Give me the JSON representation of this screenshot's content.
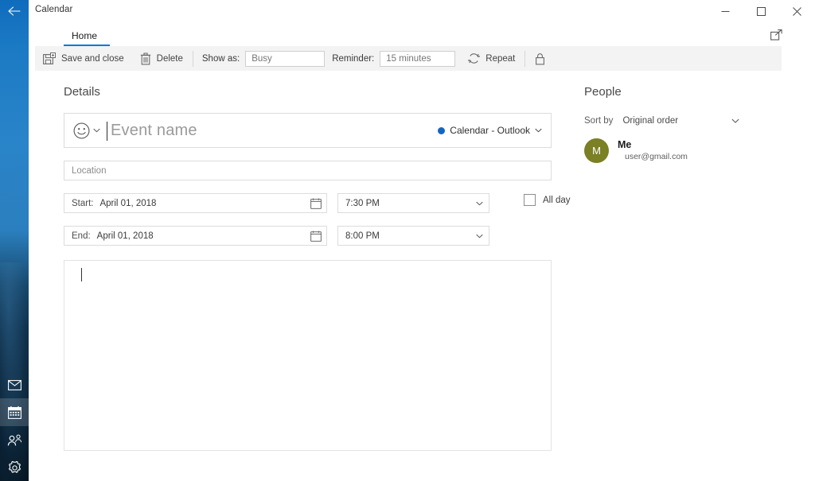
{
  "window": {
    "app_title": "Calendar",
    "back_icon": "arrow-left-icon",
    "minimize_label": "—",
    "maximize_label": "⬜",
    "close_label": "✕"
  },
  "rail": {
    "items": [
      {
        "name": "mail",
        "icon": "mail-icon",
        "active": false
      },
      {
        "name": "calendar",
        "icon": "calendar-icon",
        "active": true
      },
      {
        "name": "people",
        "icon": "people-icon",
        "active": false
      },
      {
        "name": "settings",
        "icon": "gear-icon",
        "active": false
      }
    ]
  },
  "ribbon": {
    "tab_label": "Home",
    "popout_icon": "open-in-new-window-icon",
    "save_label": "Save and close",
    "save_icon": "save-icon",
    "delete_label": "Delete",
    "delete_icon": "trash-icon",
    "show_as_label": "Show as:",
    "show_as_value": "Busy",
    "reminder_label": "Reminder:",
    "reminder_value": "15 minutes",
    "repeat_label": "Repeat",
    "repeat_icon": "repeat-icon",
    "private_icon": "lock-icon"
  },
  "details": {
    "heading": "Details",
    "emoji_icon": "smiley-icon",
    "emoji_chevron": "chevron-down-icon",
    "event_name_value": "",
    "event_name_placeholder": "Event name",
    "calendar_name": "Calendar - Outlook",
    "calendar_color": "#1565c0",
    "calendar_chevron": "chevron-down-icon",
    "location_value": "",
    "location_placeholder": "Location",
    "start_label": "Start:",
    "start_date": "April 01, 2018",
    "start_time": "7:30 PM",
    "end_label": "End:",
    "end_date": "April 01, 2018",
    "end_time": "8:00 PM",
    "date_picker_icon": "calendar-picker-icon",
    "time_chevron": "chevron-down-icon",
    "all_day_label": "All day",
    "all_day_checked": false,
    "notes_value": ""
  },
  "people": {
    "heading": "People",
    "sort_by_label": "Sort by",
    "sort_by_value": "Original order",
    "sort_chevron": "chevron-down-icon",
    "attendees": [
      {
        "initial": "M",
        "name": "Me",
        "email": "user@gmail.com",
        "avatar_color": "#7a8023"
      }
    ]
  }
}
